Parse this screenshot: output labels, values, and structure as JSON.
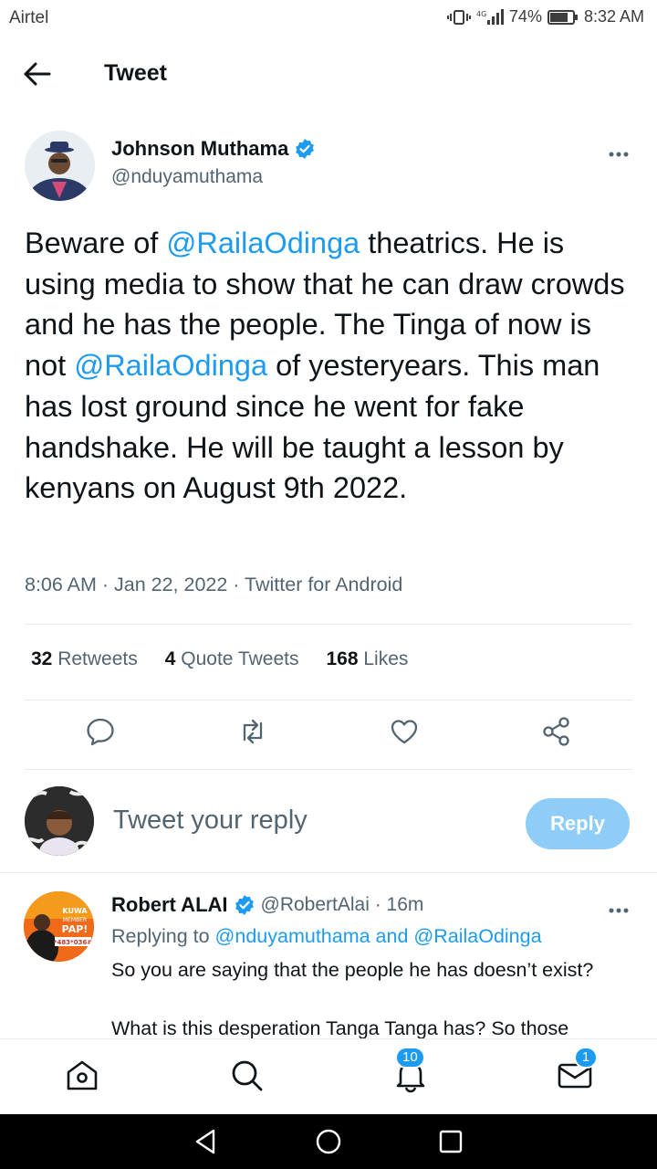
{
  "status_bar": {
    "carrier": "Airtel",
    "network": "4G",
    "battery": "74%",
    "time": "8:32 AM"
  },
  "header": {
    "title": "Tweet"
  },
  "tweet": {
    "author_name": "Johnson Muthama",
    "author_handle": "@nduyamuthama",
    "body_parts": [
      "Beware of ",
      "@RailaOdinga",
      " theatrics. He is using media to show that he can draw crowds and he has the people. The Tinga of now is not ",
      "@RailaOdinga",
      " of yesteryears. This man has lost ground since he went for fake handshake. He will be taught  a lesson by kenyans on August 9th 2022."
    ],
    "meta": "8:06 AM · Jan 22, 2022 · Twitter for Android",
    "stats": {
      "retweets_count": "32",
      "retweets_label": "Retweets",
      "quotes_count": "4",
      "quotes_label": "Quote Tweets",
      "likes_count": "168",
      "likes_label": "Likes"
    }
  },
  "compose": {
    "placeholder": "Tweet your reply",
    "button_label": "Reply"
  },
  "reply": {
    "author_name": "Robert ALAI",
    "author_handle": "@RobertAlai · 16m",
    "replying_prefix": "Replying to ",
    "replying_user1": "@nduyamuthama",
    "replying_and": " and ",
    "replying_user2": "@RailaOdinga",
    "text_line1": "So you are saying that the people he has doesn’t exist?",
    "text_line2": "What is this desperation Tanga Tanga has? So those",
    "avatar_text": "KUWA MEMBER PAP! *483*036#"
  },
  "bottom_nav": {
    "notifications_badge": "10",
    "messages_badge": "1"
  },
  "colors": {
    "accent": "#1d9bf0",
    "reply_button_disabled": "#8ecdf7",
    "secondary_text": "#536471"
  }
}
